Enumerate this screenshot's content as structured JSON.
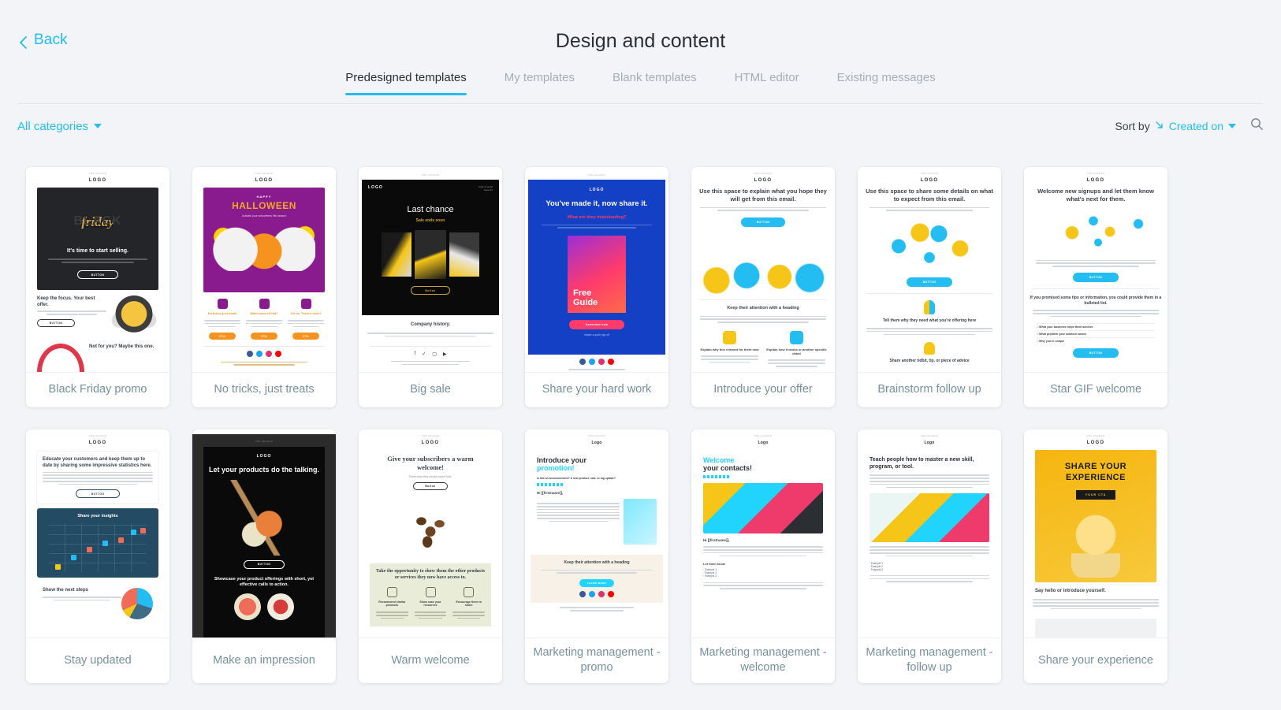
{
  "header": {
    "back_label": "Back",
    "back_icon": "chevron-left-icon",
    "title": "Design and content"
  },
  "tabs": [
    {
      "label": "Predesigned templates",
      "active": true
    },
    {
      "label": "My templates",
      "active": false
    },
    {
      "label": "Blank templates",
      "active": false
    },
    {
      "label": "HTML editor",
      "active": false
    },
    {
      "label": "Existing messages",
      "active": false
    }
  ],
  "filter_bar": {
    "categories_label": "All categories",
    "categories_caret_icon": "chevron-down-icon",
    "sort_by_label": "Sort by",
    "sort_direction_icon": "sort-descending-arrow-icon",
    "sort_value": "Created on",
    "sort_caret_icon": "chevron-down-icon",
    "search_icon": "search-icon"
  },
  "colors": {
    "accent": "#23bdf2",
    "page_background": "#f2f4f7",
    "card_background": "#ffffff",
    "label_text": "#77909e",
    "title_text": "#2b2f33",
    "tab_inactive": "#a7aeb5"
  },
  "templates": [
    {
      "label": "Black Friday promo",
      "preheader": "PRE-HEADER",
      "logo": "LOGO",
      "hero_headline": "It's time to start selling.",
      "hero_badge": "BLACK friday",
      "hero_button": "BUTTON",
      "section_headline": "Keep the focus.\nYour best offer.",
      "section_button": "BUTTON",
      "section2_headline": "Not for you?\nMaybe this one.",
      "theme": "dark-hero"
    },
    {
      "label": "No tricks, just treats",
      "preheader": "PRE-HEADER",
      "logo": "LOGO",
      "hero_kicker": "HAPPY",
      "hero_headline": "HALLOWEEN",
      "hero_sub": "Activate your subscribers this season",
      "columns": [
        {
          "title": "No tricks,\njust treats",
          "button": "CTA"
        },
        {
          "title": "Want some\nof that?",
          "button": "CTA"
        },
        {
          "title": "Go on,\nThere's more!",
          "button": "CTA"
        }
      ],
      "theme": "halloween"
    },
    {
      "label": "Big sale",
      "preheader": "PRE-HEADER",
      "logo": "LOGO",
      "hero_headline": "Last chance",
      "hero_sub": "Sale ends soon",
      "hero_button": "Button",
      "hero_corner": "Topic of email\nIssue #1",
      "section_headline": "Company history.",
      "theme": "dark-product"
    },
    {
      "label": "Share your hard work",
      "preheader": "PRE-HEADER",
      "logo": "LOGO",
      "hero_headline": "You've made it,\nnow share it.",
      "hero_sub": "What are they downloading?",
      "guide_title": "Free\nGuide",
      "hero_button": "Download now",
      "hero_note": "Maybe a quick sign off",
      "theme": "blue-gradient"
    },
    {
      "label": "Introduce your offer",
      "preheader": "PRE-HEADER",
      "logo": "LOGO",
      "hero_headline": "Use this space to explain what you hope they will get from this email.",
      "hero_button": "BUTTON",
      "section_headline": "Keep their attention with a heading",
      "columns": [
        {
          "title": "Explain why this relevant for them now"
        },
        {
          "title": "Explain how it works or another specific detail"
        }
      ],
      "theme": "illustration-people"
    },
    {
      "label": "Brainstorm follow up",
      "preheader": "PRE-HEADER",
      "logo": "LOGO",
      "hero_headline": "Use this space to share some details on what to expect from this email.",
      "hero_button": "BUTTON",
      "section_headline": "Tell them why they need what you're offering here",
      "section2_headline": "Share another tidbit, tip, or piece of advice",
      "theme": "illustration-ideas"
    },
    {
      "label": "Star GIF welcome",
      "preheader": "PRE-HEADER",
      "logo": "LOGO",
      "hero_headline": "Welcome new signups and let them know what's next for them.",
      "hero_button": "BUTTON",
      "section_headline": "If you promised some tips or information, you could provide them in a bulleted list.",
      "bullets": [
        "What your business helps them achieve",
        "What problem your solution solves",
        "Why you're unique"
      ],
      "section_button": "BUTTON",
      "theme": "stars"
    },
    {
      "label": "Stay updated",
      "preheader": "PRE-HEADER",
      "logo": "LOGO",
      "hero_headline": "Educate your customers and keep them up to date by sharing some impressive statistics here.",
      "hero_button": "BUTTON",
      "chart_title": "Share your insights",
      "section_headline": "Show the next steps",
      "theme": "charts"
    },
    {
      "label": "Make an impression",
      "preheader": "PRE-HEADER",
      "logo": "LOGO",
      "hero_headline": "Let your products do the talking.",
      "hero_button": "BUTTON",
      "section_headline": "Showcase your product offerings with short, yet effective calls to action.",
      "theme": "dark-food"
    },
    {
      "label": "Warm welcome",
      "preheader": "PRE-HEADER",
      "logo": "LOGO",
      "hero_headline": "Give your subscribers a warm welcome!",
      "hero_sub": "Share what they should expect next.",
      "hero_button": "Button",
      "section_headline": "Take the opportunity to show them the other products or services they now have access to.",
      "columns": [
        {
          "title": "Recommend similar products"
        },
        {
          "title": "Show case your resources"
        },
        {
          "title": "Encourage them to share"
        }
      ],
      "theme": "coffee"
    },
    {
      "label": "Marketing management - promo",
      "preheader": "PRE-HEADER",
      "logo": "Logo",
      "hero_headline": "Introduce your",
      "hero_headline_accent": "promotion!",
      "hero_sub": "Is this an announcement? A new product, sale, or big update?",
      "greeting": "Hi [[firstname]],",
      "section_headline": "Keep their attention with a heading",
      "section_button": "LEARN MORE",
      "theme": "mm-promo"
    },
    {
      "label": "Marketing management - welcome",
      "preheader": "PRE-HEADER",
      "logo": "Logo",
      "hero_headline": "Welcome",
      "hero_headline_2": "your contacts!",
      "greeting": "Hi [[firstname]],",
      "section_headline": "Let them know",
      "bullets": [
        "Example 1",
        "Example 2",
        "Example 3"
      ],
      "theme": "mm-welcome"
    },
    {
      "label": "Marketing management - follow up",
      "preheader": "PRE-HEADER",
      "logo": "Logo",
      "hero_headline": "Teach people how to master a new skill, program, or tool.",
      "bullets": [
        "Example 1",
        "Example 2",
        "Example 3"
      ],
      "theme": "mm-followup"
    },
    {
      "label": "Share your experience",
      "preheader": "PRE-HEADER",
      "logo": "LOGO",
      "hero_headline": "SHARE YOUR EXPERIENCE",
      "hero_button": "YOUR CTA",
      "section_headline": "Say hello or introduce yourself.",
      "theme": "lightbulb"
    }
  ]
}
